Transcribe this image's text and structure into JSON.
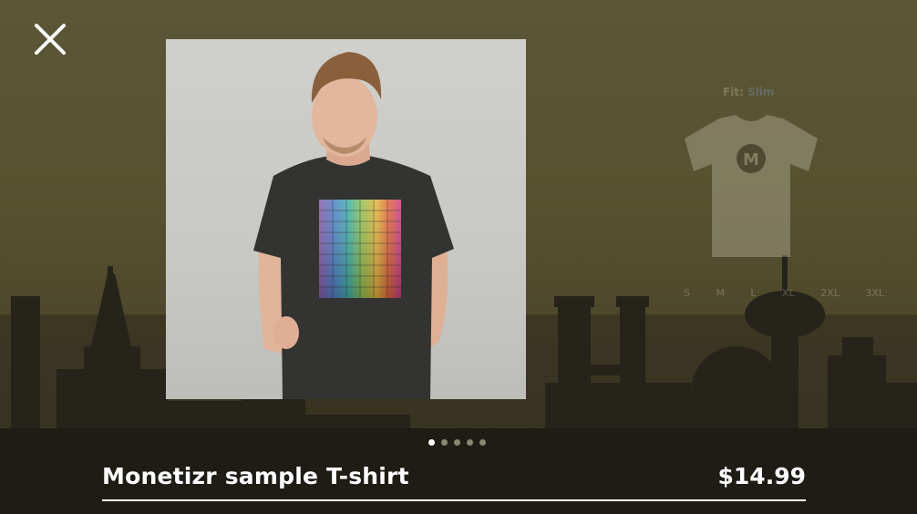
{
  "modal": {
    "close_icon": "close-icon"
  },
  "product": {
    "title": "Monetizr sample T-shirt",
    "price": "$14.99",
    "image_count": 5,
    "active_image": 1
  },
  "background_detail": {
    "fit_label": "Fit:",
    "fit_value": "Slim",
    "sizes": [
      "S",
      "M",
      "L",
      "XL",
      "2XL",
      "3XL"
    ]
  },
  "colors": {
    "accent": "#ffffff",
    "backdrop": "#56512f"
  }
}
